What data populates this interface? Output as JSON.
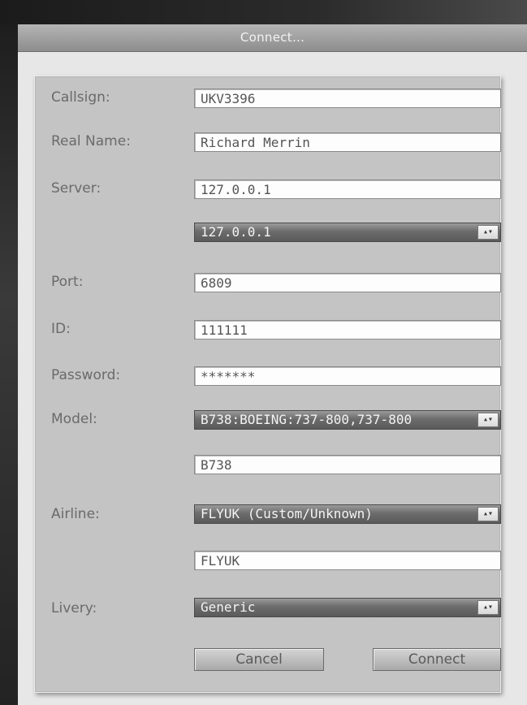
{
  "window": {
    "title": "Connect..."
  },
  "form": {
    "callsign": {
      "label": "Callsign:",
      "value": "UKV3396"
    },
    "real_name": {
      "label": "Real Name:",
      "value": "Richard Merrin"
    },
    "server": {
      "label": "Server:",
      "value": "127.0.0.1",
      "select_value": "127.0.0.1"
    },
    "port": {
      "label": "Port:",
      "value": "6809"
    },
    "id": {
      "label": "ID:",
      "value": "111111"
    },
    "password": {
      "label": "Password:",
      "value": "*******"
    },
    "model": {
      "label": "Model:",
      "select_value": "B738:BOEING:737-800,737-800",
      "value": "B738"
    },
    "airline": {
      "label": "Airline:",
      "select_value": "FLYUK (Custom/Unknown)",
      "value": "FLYUK"
    },
    "livery": {
      "label": "Livery:",
      "select_value": "Generic"
    }
  },
  "buttons": {
    "cancel": "Cancel",
    "connect": "Connect"
  },
  "icons": {
    "select_arrow": "updown-arrow-icon"
  }
}
